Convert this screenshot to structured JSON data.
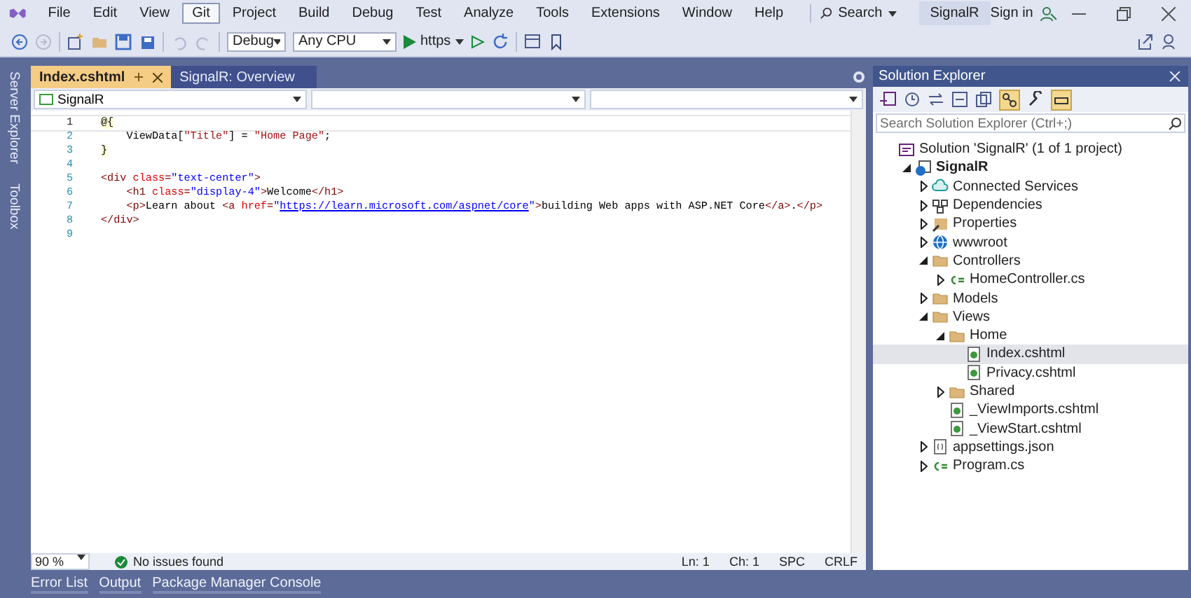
{
  "menu": [
    {
      "label": "File",
      "selected": false
    },
    {
      "label": "Edit",
      "selected": false
    },
    {
      "label": "View",
      "selected": false
    },
    {
      "label": "Git",
      "selected": true
    },
    {
      "label": "Project",
      "selected": false
    },
    {
      "label": "Build",
      "selected": false
    },
    {
      "label": "Debug",
      "selected": false
    },
    {
      "label": "Test",
      "selected": false
    },
    {
      "label": "Analyze",
      "selected": false
    },
    {
      "label": "Tools",
      "selected": false
    },
    {
      "label": "Extensions",
      "selected": false
    },
    {
      "label": "Window",
      "selected": false
    },
    {
      "label": "Help",
      "selected": false
    }
  ],
  "search": "Search",
  "solution_badge": "SignalR",
  "sign_in": "Sign in",
  "toolbar": {
    "configuration": "Debug",
    "platform": "Any CPU",
    "run": "https"
  },
  "side_tabs": [
    "Server Explorer",
    "Toolbox"
  ],
  "doc_tabs": [
    {
      "label": "Index.cshtml",
      "selected": true
    },
    {
      "label": "SignalR: Overview",
      "selected": false
    }
  ],
  "nav_bar": {
    "project": "SignalR"
  },
  "code": [
    {
      "number": "1",
      "current": true,
      "tokens": [
        {
          "kind": "razor",
          "text": "@{"
        }
      ]
    },
    {
      "number": "2",
      "current": false,
      "tokens": [
        {
          "kind": "plain",
          "text": "    ViewData["
        },
        {
          "kind": "string",
          "text": "\"Title\""
        },
        {
          "kind": "plain",
          "text": "] = "
        },
        {
          "kind": "string",
          "text": "\"Home Page\""
        },
        {
          "kind": "plain",
          "text": ";"
        }
      ]
    },
    {
      "number": "3",
      "current": false,
      "tokens": [
        {
          "kind": "razor",
          "text": "}"
        }
      ]
    },
    {
      "number": "4",
      "current": false
    },
    {
      "number": "5",
      "current": false,
      "tokens": [
        {
          "kind": "tag",
          "text": "<div "
        },
        {
          "kind": "attr",
          "text": "class"
        },
        {
          "kind": "tag",
          "text": "="
        },
        {
          "kind": "value",
          "text": "\"text-center\""
        },
        {
          "kind": "tag",
          "text": ">"
        }
      ]
    },
    {
      "number": "6",
      "current": false,
      "tokens": [
        {
          "kind": "tag",
          "text": "    <h1 "
        },
        {
          "kind": "attr",
          "text": "class"
        },
        {
          "kind": "tag",
          "text": "="
        },
        {
          "kind": "value",
          "text": "\"display-4\""
        },
        {
          "kind": "tag",
          "text": ">"
        },
        {
          "kind": "plain",
          "text": "Welcome"
        },
        {
          "kind": "tag",
          "text": "</h1>"
        }
      ]
    },
    {
      "number": "7",
      "current": false,
      "tokens": [
        {
          "kind": "tag",
          "text": "    <p>"
        },
        {
          "kind": "plain",
          "text": "Learn about "
        },
        {
          "kind": "tag",
          "text": "<a "
        },
        {
          "kind": "attr",
          "text": "href"
        },
        {
          "kind": "tag",
          "text": "="
        },
        {
          "kind": "value",
          "text": "\""
        },
        {
          "kind": "link",
          "text": "https://learn.microsoft.com/aspnet/core"
        },
        {
          "kind": "value",
          "text": "\""
        },
        {
          "kind": "tag",
          "text": ">"
        },
        {
          "kind": "plain",
          "text": "building Web apps with ASP.NET Core"
        },
        {
          "kind": "tag",
          "text": "</a>"
        },
        {
          "kind": "plain",
          "text": "."
        },
        {
          "kind": "tag",
          "text": "</p>"
        }
      ]
    },
    {
      "number": "8",
      "current": false,
      "tokens": [
        {
          "kind": "tag",
          "text": "</div>"
        }
      ]
    },
    {
      "number": "9",
      "current": false
    }
  ],
  "status": {
    "zoom": "90 %",
    "issues": "No issues found",
    "line": "Ln: 1",
    "column": "Ch: 1",
    "whitespace": "SPC",
    "line_endings": "CRLF"
  },
  "solution_explorer": {
    "title": "Solution Explorer",
    "search_placeholder": "Search Solution Explorer (Ctrl+;)",
    "tree": [
      {
        "label": "Solution 'SignalR' (1 of 1 project)",
        "kind": "solution",
        "selected": false,
        "children": [
          {
            "label": "SignalR",
            "kind": "project",
            "expanded": true,
            "selected": false,
            "children": [
              {
                "label": "Connected Services",
                "kind": "cloud",
                "expanded": false,
                "selected": false
              },
              {
                "label": "Dependencies",
                "kind": "deps",
                "expanded": false,
                "selected": false
              },
              {
                "label": "Properties",
                "kind": "props",
                "expanded": false,
                "selected": false
              },
              {
                "label": "wwwroot",
                "kind": "globe",
                "expanded": false,
                "selected": false
              },
              {
                "label": "Controllers",
                "kind": "folder",
                "expanded": true,
                "selected": false,
                "children": [
                  {
                    "label": "HomeController.cs",
                    "kind": "cs",
                    "expanded": false,
                    "selected": false
                  }
                ]
              },
              {
                "label": "Models",
                "kind": "folder",
                "expanded": false,
                "selected": false
              },
              {
                "label": "Views",
                "kind": "folder",
                "expanded": true,
                "selected": false,
                "children": [
                  {
                    "label": "Home",
                    "kind": "folder",
                    "expanded": true,
                    "selected": false,
                    "children": [
                      {
                        "label": "Index.cshtml",
                        "kind": "razor",
                        "selected": true
                      },
                      {
                        "label": "Privacy.cshtml",
                        "kind": "razor",
                        "selected": false
                      }
                    ]
                  },
                  {
                    "label": "Shared",
                    "kind": "folder",
                    "expanded": false,
                    "selected": false
                  },
                  {
                    "label": "_ViewImports.cshtml",
                    "kind": "razor",
                    "selected": false
                  },
                  {
                    "label": "_ViewStart.cshtml",
                    "kind": "razor",
                    "selected": false
                  }
                ]
              },
              {
                "label": "appsettings.json",
                "kind": "json",
                "expanded": false,
                "selected": false
              },
              {
                "label": "Program.cs",
                "kind": "cs",
                "expanded": false,
                "selected": false
              }
            ]
          }
        ]
      }
    ]
  },
  "bottom_tabs": [
    "Error List",
    "Output",
    "Package Manager Console"
  ]
}
